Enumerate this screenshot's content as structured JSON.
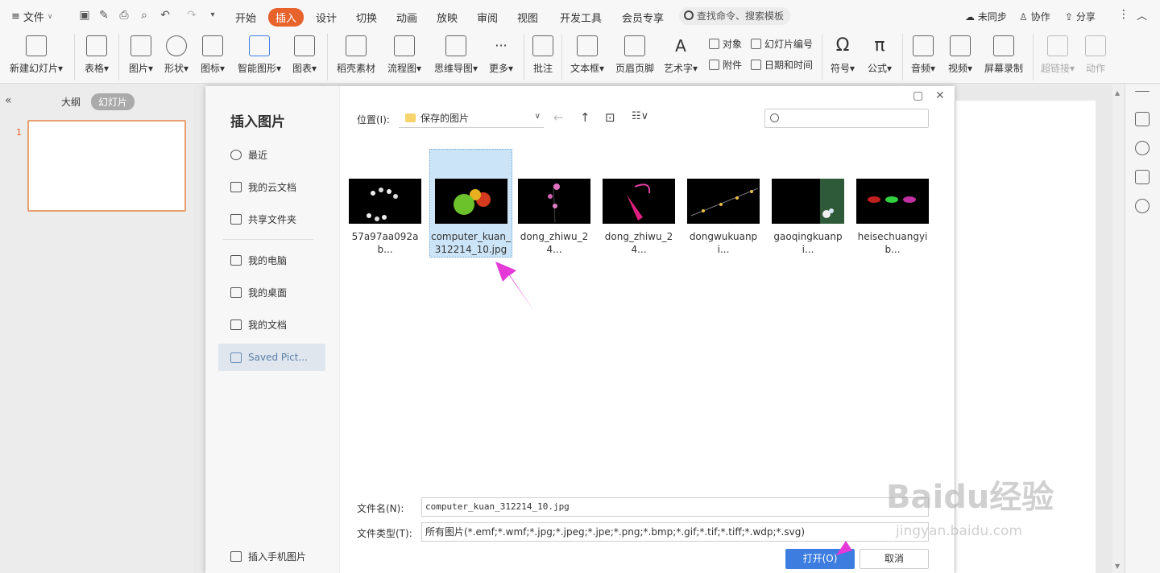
{
  "menu": {
    "file_label": "文件",
    "tabs": [
      "开始",
      "插入",
      "设计",
      "切换",
      "动画",
      "放映",
      "审阅",
      "视图",
      "开发工具",
      "会员专享"
    ],
    "active_tab": "插入",
    "search_placeholder": "查找命令、搜索模板",
    "right": {
      "sync": "未同步",
      "collab": "协作",
      "share": "分享"
    }
  },
  "ribbon": {
    "buttons": [
      "新建幻灯片",
      "表格",
      "图片",
      "形状",
      "图标",
      "智能图形",
      "图表",
      "稻壳素材",
      "流程图",
      "思维导图",
      "更多",
      "批注",
      "文本框",
      "页眉页脚",
      "艺术字",
      "符号",
      "公式",
      "音频",
      "视频",
      "屏幕录制",
      "超链接",
      "动作"
    ],
    "small": {
      "object": "对象",
      "attach": "附件",
      "slide_num": "幻灯片编号",
      "datetime": "日期和时间"
    }
  },
  "left_panel": {
    "outline": "大纲",
    "slides": "幻灯片",
    "slide_number": "1"
  },
  "dialog": {
    "title": "插入图片",
    "nav": [
      "最近",
      "我的云文档",
      "共享文件夹",
      "我的电脑",
      "我的桌面",
      "我的文档",
      "Saved Pict..."
    ],
    "active_nav": "Saved Pict...",
    "insert_phone": "插入手机图片",
    "location_label": "位置(I):",
    "location_value": "保存的图片",
    "search_placeholder": "",
    "files": [
      {
        "name": "57a97aa092ab..."
      },
      {
        "name": "computer_kuan_312214_10.jpg",
        "selected": true
      },
      {
        "name": "dong_zhiwu_24..."
      },
      {
        "name": "dong_zhiwu_24..."
      },
      {
        "name": "dongwukuanpi..."
      },
      {
        "name": "gaoqingkuanpi..."
      },
      {
        "name": "heisechuangyib..."
      }
    ],
    "filename_label": "文件名(N):",
    "filename_value": "computer_kuan_312214_10.jpg",
    "filetype_label": "文件类型(T):",
    "filetype_value": "所有图片(*.emf;*.wmf;*.jpg;*.jpeg;*.jpe;*.png;*.bmp;*.gif;*.tif;*.tiff;*.wdp;*.svg)",
    "open_button": "打开(O)",
    "cancel_button": "取消"
  },
  "watermark": {
    "brand": "Baidu经验",
    "url": "jingyan.baidu.com"
  },
  "colors": {
    "accent": "#e8622c",
    "primary_button": "#3e7de0",
    "annotation_arrow": "#e53ad8"
  }
}
